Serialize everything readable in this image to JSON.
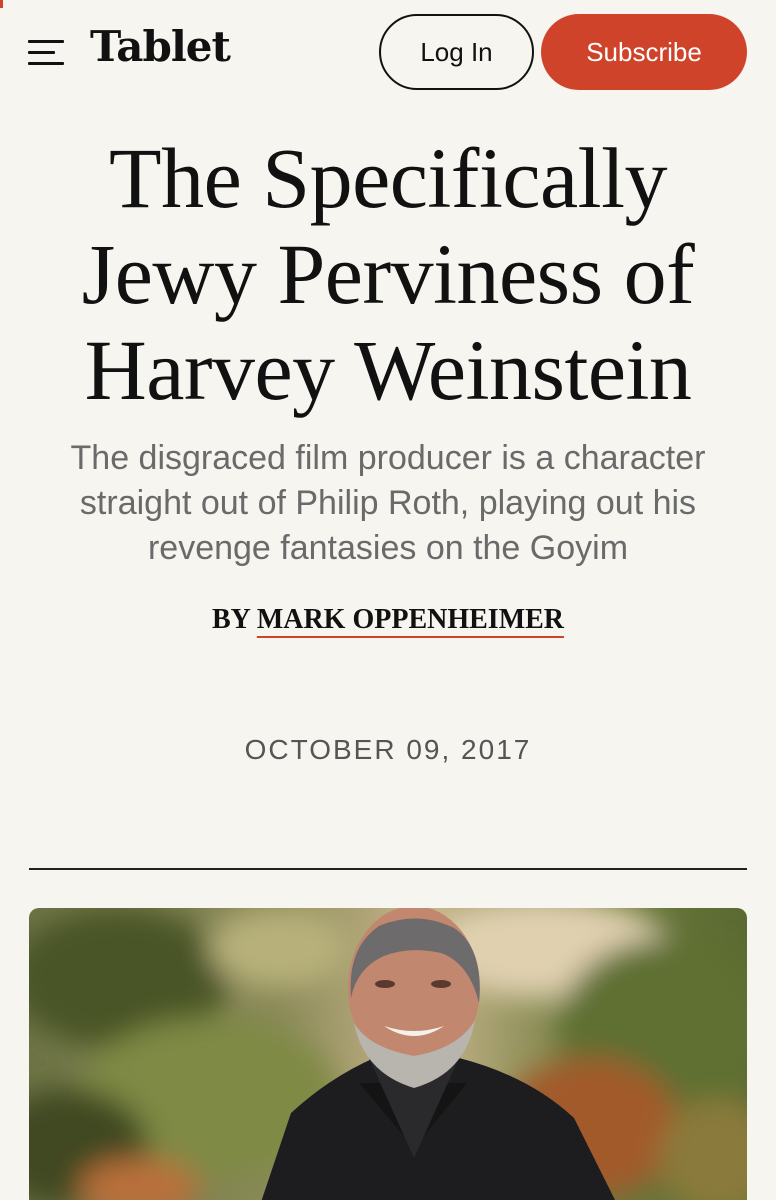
{
  "header": {
    "logo": "Tablet",
    "login_label": "Log In",
    "subscribe_label": "Subscribe",
    "accent_color": "#d0432b"
  },
  "article": {
    "headline_lines": [
      "The Specifically",
      "Jewy Perviness of",
      "Harvey Weinstein"
    ],
    "dek_lines": [
      "The disgraced film producer is a character",
      "straight out of Philip Roth, playing out his",
      "revenge fantasies on the Goyim"
    ],
    "byline_prefix": "BY",
    "author": "MARK OPPENHEIMER",
    "date": "OCTOBER 09, 2017"
  },
  "icons": {
    "menu": "hamburger-menu-icon"
  }
}
